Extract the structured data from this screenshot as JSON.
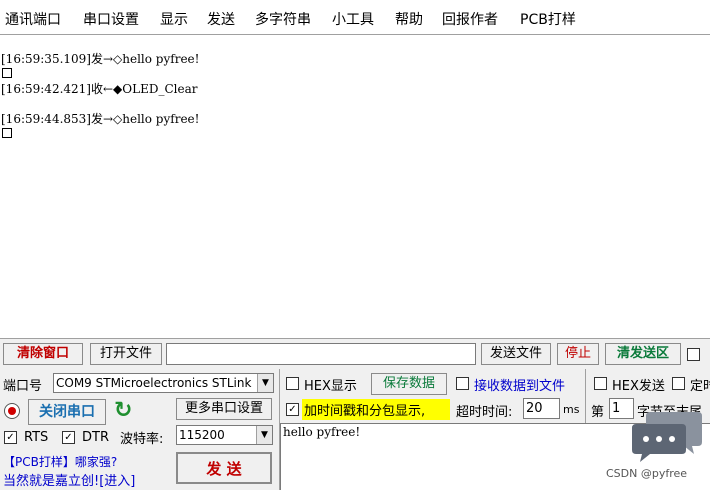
{
  "menu": [
    "通讯端口",
    "串口设置",
    "显示",
    "发送",
    "多字符串",
    "小工具",
    "帮助",
    "回报作者",
    "PCB打样"
  ],
  "receive": {
    "lines": [
      "[16:59:35.109]发→◇hello pyfree!",
      "[16:59:42.421]收←◆OLED_Clear",
      "[16:59:44.853]发→◇hello pyfree!"
    ]
  },
  "toolbar": {
    "clear_window": "清除窗口",
    "open_file": "打开文件",
    "file_path": "",
    "send_file": "发送文件",
    "stop": "停止",
    "clear_send_area": "清发送区"
  },
  "port": {
    "label": "端口号",
    "selected": "COM9 STMicroelectronics STLink",
    "close_port": "关闭串口",
    "more_settings": "更多串口设置",
    "rts": "RTS",
    "dtr": "DTR",
    "baud_label": "波特率:",
    "baud": "115200"
  },
  "options": {
    "hex_display": "HEX显示",
    "save_data": "保存数据",
    "recv_to_file": "接收数据到文件",
    "hex_send": "HEX发送",
    "timed_send": "定时发送",
    "timestamp_split": "加时间戳和分包显示,",
    "timeout_label": "超时时间:",
    "timeout_value": "20",
    "timeout_unit": "ms",
    "nth_label": "第",
    "nth_value": "1",
    "bytes_to_end": "字节至末尾"
  },
  "send": {
    "button": "发  送",
    "text": "hello pyfree!"
  },
  "promo": {
    "line1": "【PCB打样】哪家强?",
    "line2": "当然就是嘉立创![进入]"
  },
  "watermark": "CSDN @pyfree",
  "colors": {
    "highlight": "#ffff00",
    "link_blue": "#0000cc",
    "red": "#c00000",
    "green": "#0a7a3a"
  }
}
